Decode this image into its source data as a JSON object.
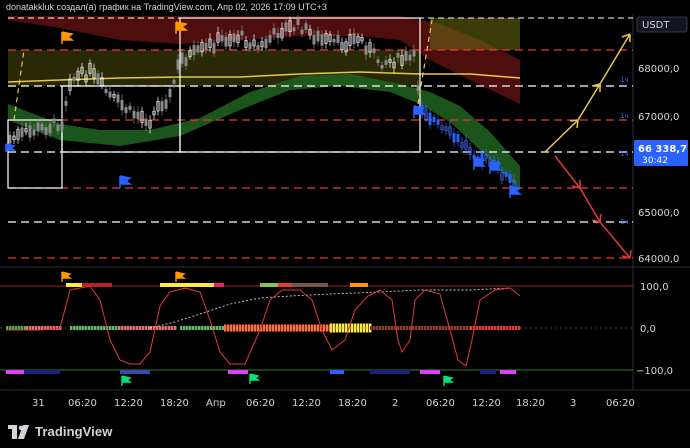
{
  "header": {
    "title": "donatakkluk создал(а) график на TradingView.com, Апр 02, 2026 17:09 UTC+3"
  },
  "currency": "USDT",
  "price_axis": {
    "ticks": [
      "68000,0",
      "67000,0",
      "65000,0",
      "64000,0"
    ],
    "current_price": "66 338,7",
    "countdown": "30:42",
    "accent": "#2962ff"
  },
  "oscillator_axis": {
    "ticks": [
      "100,0",
      "0,0",
      "−100,0"
    ]
  },
  "time_axis": {
    "ticks": [
      "31",
      "06:20",
      "12:20",
      "18:20",
      "Апр",
      "06:20",
      "12:20",
      "18:20",
      "2",
      "06:20",
      "12:20",
      "18:20",
      "3",
      "06:20"
    ]
  },
  "tf_labels": [
    "1ч",
    "1ч",
    "1ч",
    "1ч"
  ],
  "colors": {
    "up": "#ffffff",
    "down": "#9a9a9a",
    "dashed_red": "#e53935",
    "dashed_white": "#ffffff",
    "arrow_yellow": "#e6c84a",
    "arrow_red": "#e53935",
    "band_green": "#2e7d32",
    "band_red": "#8b1a1a",
    "flag_orange": "#ff9800",
    "flag_blue": "#2962ff",
    "flag_green": "#00e676"
  },
  "footer": {
    "brand": "TradingView"
  }
}
